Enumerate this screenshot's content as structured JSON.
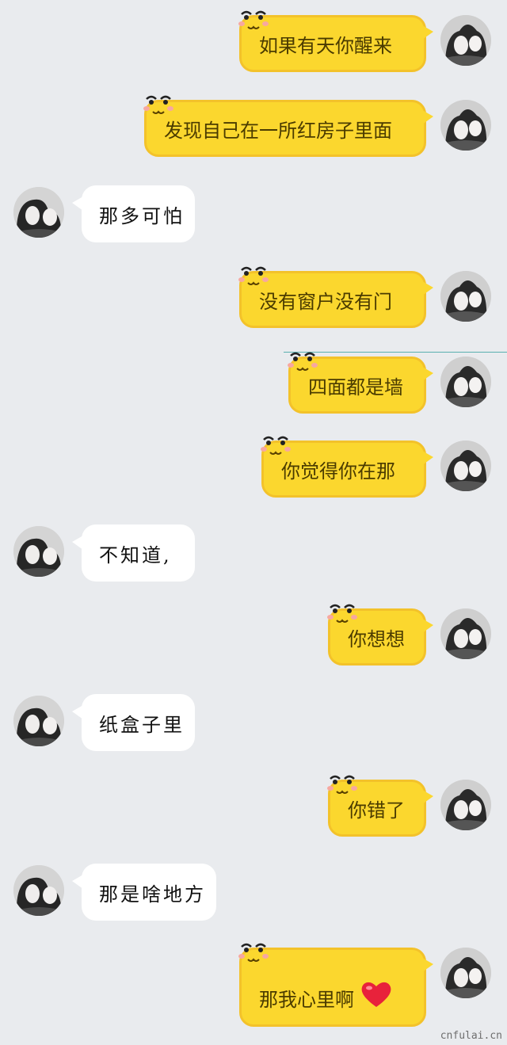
{
  "messages": [
    {
      "side": "me",
      "text": "如果有天你醒来"
    },
    {
      "side": "me",
      "text": "发现自己在一所红房子里面"
    },
    {
      "side": "them",
      "text": "那多可怕"
    },
    {
      "side": "me",
      "text": "没有窗户没有门"
    },
    {
      "side": "me",
      "text": "四面都是墙"
    },
    {
      "side": "me",
      "text": "你觉得你在那"
    },
    {
      "side": "them",
      "text": "不知道,"
    },
    {
      "side": "me",
      "text": "你想想"
    },
    {
      "side": "them",
      "text": "纸盒子里"
    },
    {
      "side": "me",
      "text": "你错了"
    },
    {
      "side": "them",
      "text": "那是啥地方"
    },
    {
      "side": "me",
      "text": "那我心里啊",
      "icon": "heart-icon"
    }
  ],
  "watermark": "cnfulai.cn",
  "colors": {
    "background": "#e9ebee",
    "me_bubble": "#fbd72e",
    "them_bubble": "#ffffff",
    "heart": "#e8223b"
  }
}
